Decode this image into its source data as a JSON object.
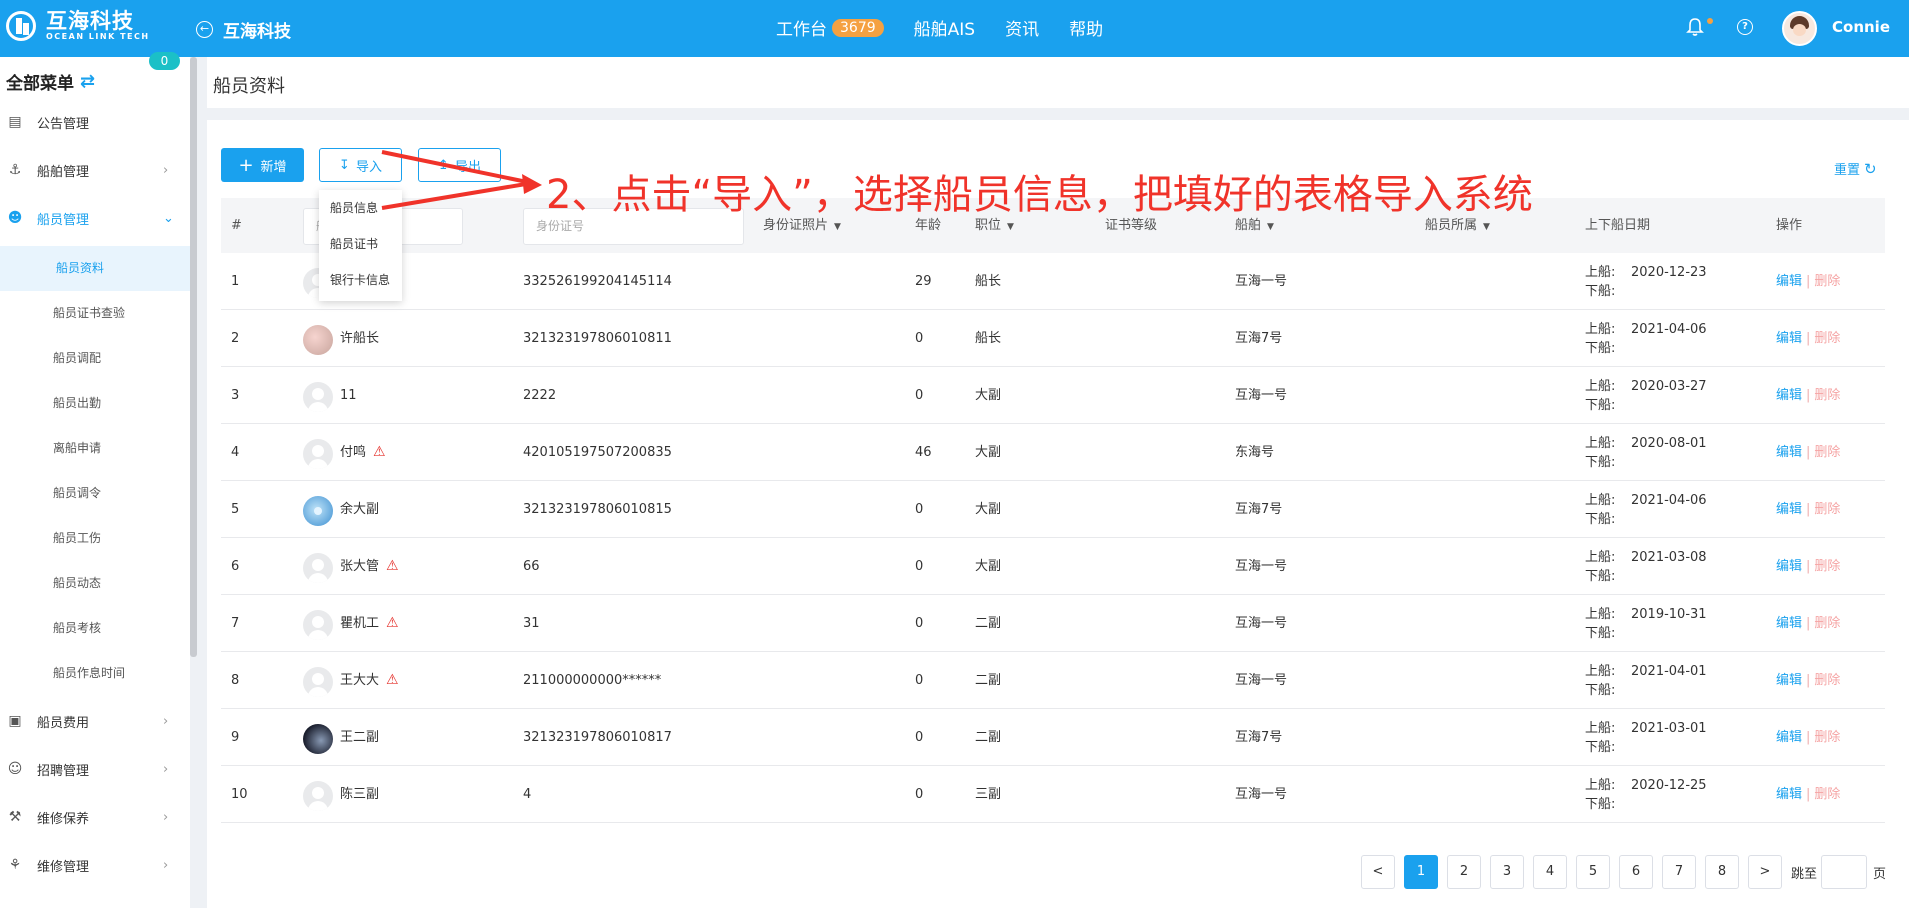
{
  "header": {
    "brand_cn": "互海科技",
    "brand_en": "OCEAN LINK TECH",
    "back_title": "互海科技",
    "nav": [
      {
        "label": "工作台",
        "badge": "3679"
      },
      {
        "label": "船舶AIS"
      },
      {
        "label": "资讯"
      },
      {
        "label": "帮助"
      }
    ],
    "username": "Connie"
  },
  "sidebar": {
    "heading": "全部菜单",
    "items": [
      {
        "label": "公告管理",
        "icon": "book-icon",
        "badge": "0"
      },
      {
        "label": "船舶管理",
        "icon": "anchor-icon"
      },
      {
        "label": "船员管理",
        "icon": "user-icon",
        "open": true
      },
      {
        "label": "船员费用",
        "icon": "wallet-icon"
      },
      {
        "label": "招聘管理",
        "icon": "user-add-icon"
      },
      {
        "label": "维修保养",
        "icon": "hammer-icon"
      },
      {
        "label": "维修管理",
        "icon": "wrench-icon"
      }
    ],
    "subitems": [
      "船员资料",
      "船员证书查验",
      "船员调配",
      "船员出勤",
      "离船申请",
      "船员调令",
      "船员工伤",
      "船员动态",
      "船员考核",
      "船员作息时间"
    ]
  },
  "page": {
    "title": "船员资料",
    "add_label": "新增",
    "import_label": "导入",
    "export_label": "导出",
    "reset_label": "重置",
    "import_menu": [
      "船员信息",
      "船员证书",
      "银行卡信息"
    ],
    "annotation": "2、点击“导入”，选择船员信息，把填好的表格导入系统"
  },
  "table": {
    "headers": {
      "index": "#",
      "name_placeholder": "船",
      "id_placeholder": "身份证号",
      "id_photo": "身份证照片",
      "age": "年龄",
      "position": "职位",
      "cert_level": "证书等级",
      "ship": "船舶",
      "ship_owner": "船员所属",
      "dates": "上下船日期",
      "actions": "操作"
    },
    "date_on_label": "上船:",
    "date_off_label": "下船:",
    "edit_label": "编辑",
    "delete_label": "删除",
    "rows": [
      {
        "no": "1",
        "name": "",
        "id": "332526199204145114",
        "age": "29",
        "position": "船长",
        "ship": "互海一号",
        "on": "2020-12-23"
      },
      {
        "no": "2",
        "name": "许船长",
        "id": "321323197806010811",
        "age": "0",
        "position": "船长",
        "ship": "互海7号",
        "on": "2021-04-06"
      },
      {
        "no": "3",
        "name": "11",
        "id": "2222",
        "age": "0",
        "position": "大副",
        "ship": "互海一号",
        "on": "2020-03-27"
      },
      {
        "no": "4",
        "name": "付鸣",
        "id": "420105197507200835",
        "age": "46",
        "position": "大副",
        "ship": "东海号",
        "on": "2020-08-01"
      },
      {
        "no": "5",
        "name": "余大副",
        "id": "321323197806010815",
        "age": "0",
        "position": "大副",
        "ship": "互海7号",
        "on": "2021-04-06"
      },
      {
        "no": "6",
        "name": "张大管",
        "id": "66",
        "age": "0",
        "position": "大副",
        "ship": "互海一号",
        "on": "2021-03-08"
      },
      {
        "no": "7",
        "name": "瞿机工",
        "id": "31",
        "age": "0",
        "position": "二副",
        "ship": "互海一号",
        "on": "2019-10-31"
      },
      {
        "no": "8",
        "name": "王大大",
        "id": "211000000000******",
        "age": "0",
        "position": "二副",
        "ship": "互海一号",
        "on": "2021-04-01"
      },
      {
        "no": "9",
        "name": "王二副",
        "id": "321323197806010817",
        "age": "0",
        "position": "二副",
        "ship": "互海7号",
        "on": "2021-03-01"
      },
      {
        "no": "10",
        "name": "陈三副",
        "id": "4",
        "age": "0",
        "position": "三副",
        "ship": "互海一号",
        "on": "2020-12-25"
      }
    ]
  },
  "pagination": {
    "prev": "<",
    "pages": [
      "1",
      "2",
      "3",
      "4",
      "5",
      "6",
      "7",
      "8"
    ],
    "current": "1",
    "next": ">",
    "jump_label": "跳至",
    "page_unit": "页"
  },
  "colors": {
    "primary": "#1aa1ee",
    "annotation": "#f0332a",
    "warn": "#e5322d"
  }
}
